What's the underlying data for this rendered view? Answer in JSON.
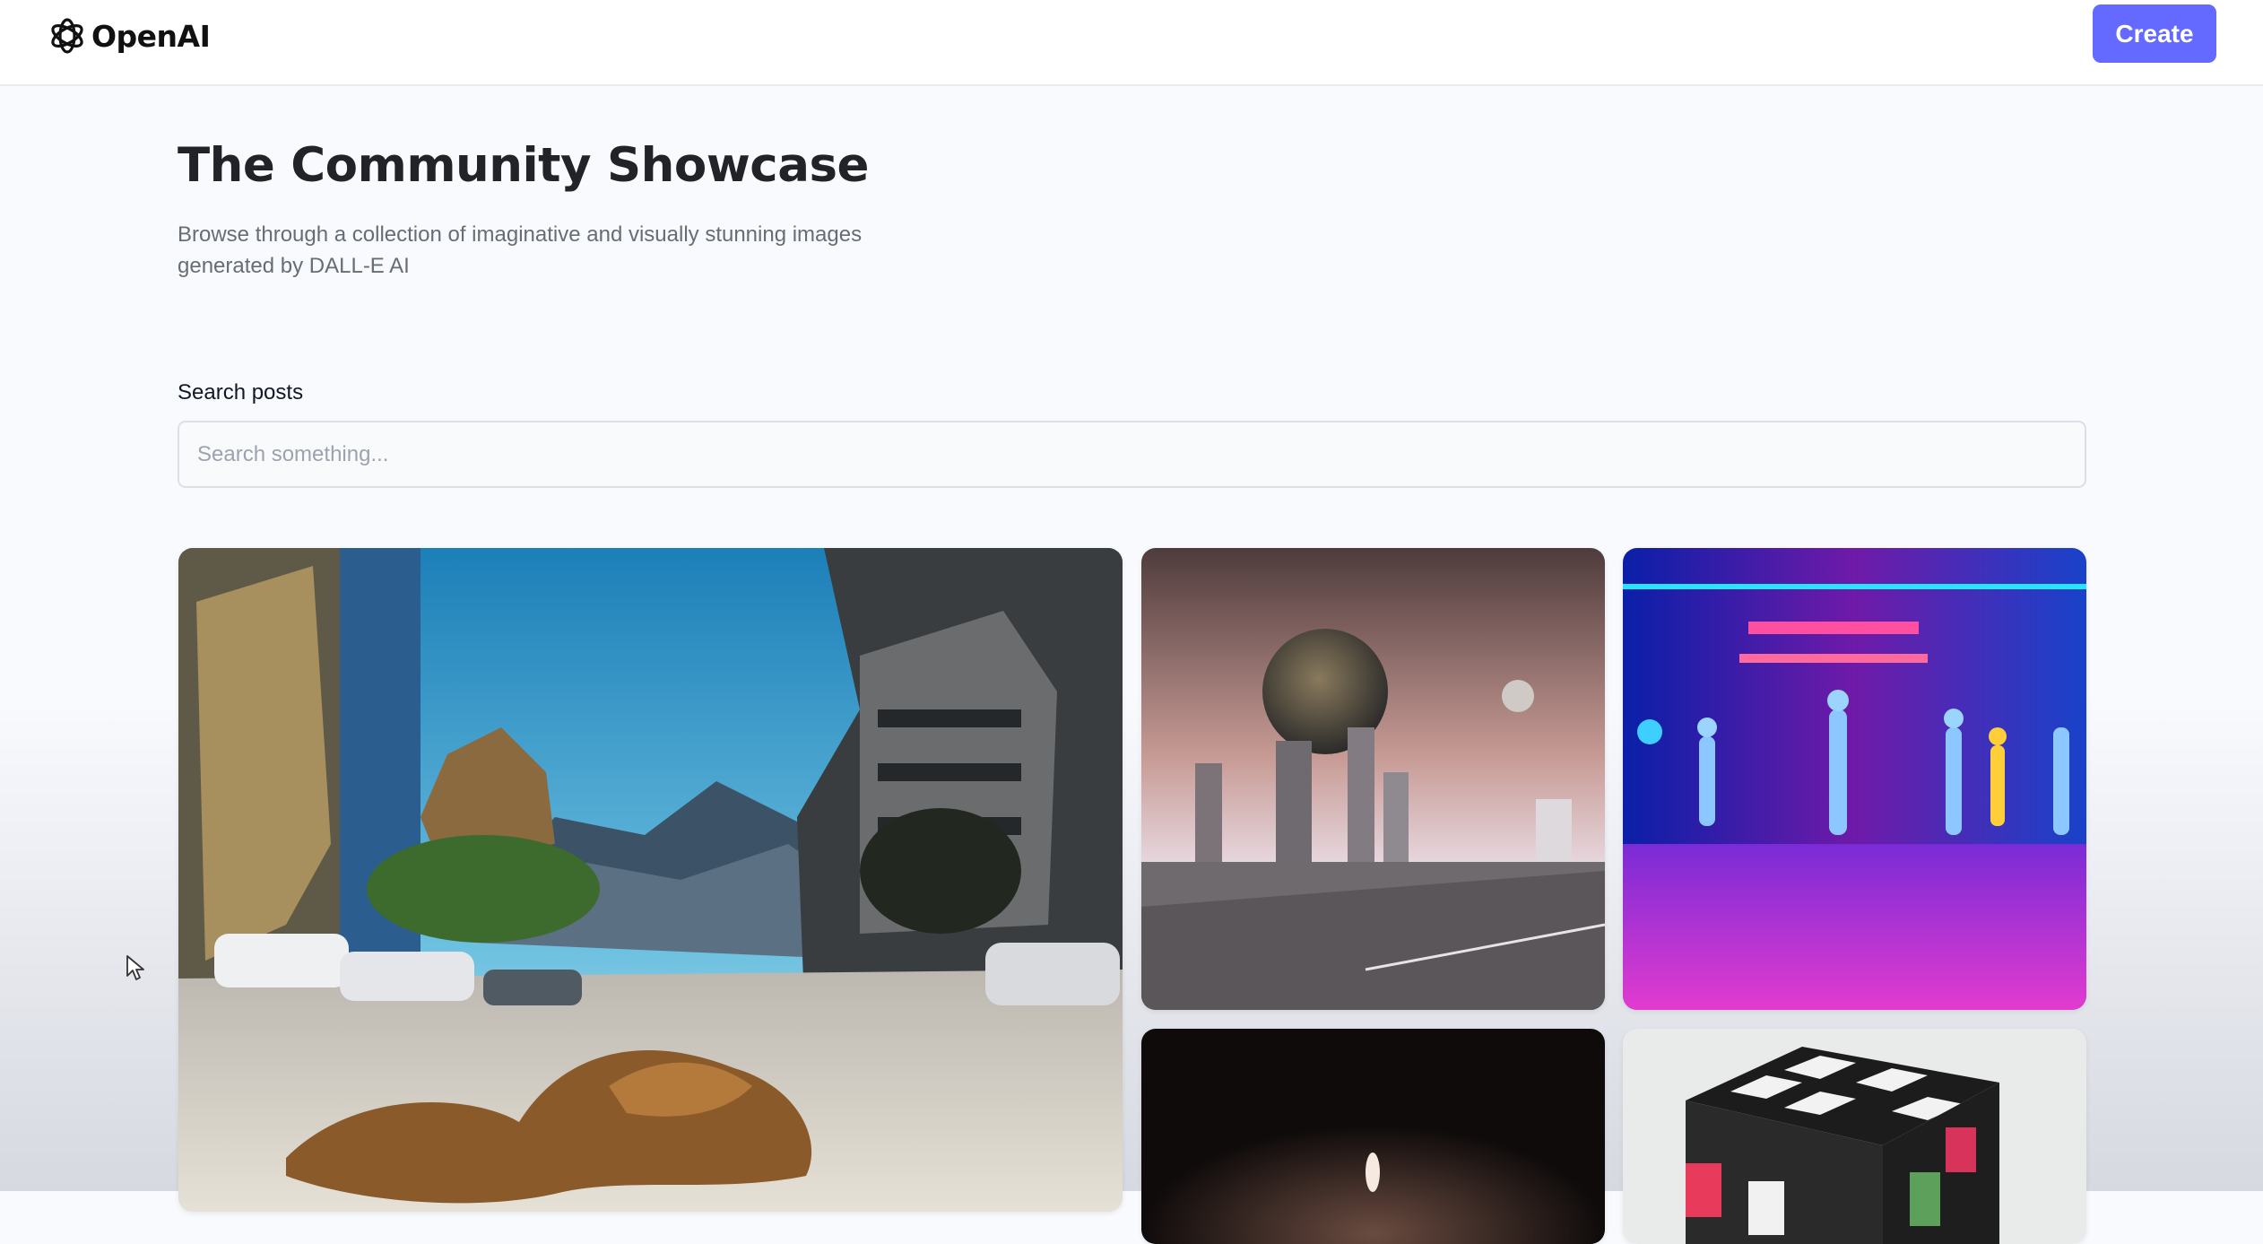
{
  "header": {
    "logo_text": "OpenAI",
    "logo_icon": "openai-knot-icon",
    "create_label": "Create",
    "accent_color": "#6469ff"
  },
  "hero": {
    "title": "The Community Showcase",
    "subtitle": "Browse through a collection of imaginative and visually stunning images generated by DALL-E AI"
  },
  "search": {
    "label": "Search posts",
    "placeholder": "Search something...",
    "value": ""
  },
  "gallery": {
    "posts": [
      {
        "subject": "beach-town-scene"
      },
      {
        "subject": "city-under-giant-planet"
      },
      {
        "subject": "neon-dancers-stage"
      },
      {
        "subject": "dark-candle-flame"
      },
      {
        "subject": "rubiks-cube"
      }
    ]
  },
  "colors": {
    "page_background": "#f9fafe",
    "title": "#222328",
    "subtitle": "#666e75"
  }
}
